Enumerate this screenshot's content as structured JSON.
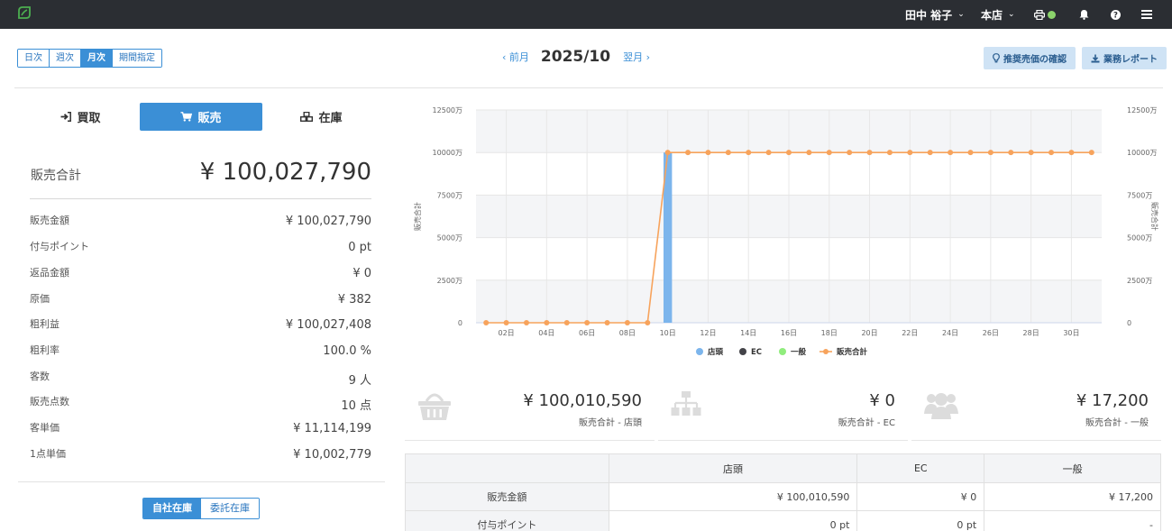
{
  "header": {
    "user": "田中 裕子",
    "store": "本店",
    "icons": [
      "leaf-logo-icon",
      "printer-icon",
      "status-dot-icon",
      "bell-icon",
      "help-icon",
      "menu-icon"
    ]
  },
  "period": {
    "tabs": [
      "日次",
      "週次",
      "月次",
      "期間指定"
    ],
    "active": "月次",
    "prev": "‹ 前月",
    "current": "2025/10",
    "next": "翌月 ›"
  },
  "actions": {
    "recommend": "推奨売価の確認",
    "report": "業務レポート"
  },
  "modes": {
    "buy": "買取",
    "sell": "販売",
    "stock": "在庫",
    "active": "販売"
  },
  "summary": {
    "total_label": "販売合計",
    "total_value": "¥ 100,027,790",
    "rows": [
      {
        "label": "販売金額",
        "value": "¥ 100,027,790"
      },
      {
        "label": "付与ポイント",
        "value": "0 pt"
      },
      {
        "label": "返品金額",
        "value": "¥ 0"
      },
      {
        "label": "原価",
        "value": "¥ 382"
      },
      {
        "label": "粗利益",
        "value": "¥ 100,027,408"
      },
      {
        "label": "粗利率",
        "value": "100.0 %"
      },
      {
        "label": "客数",
        "value": "9 人"
      },
      {
        "label": "販売点数",
        "value": "10 点"
      },
      {
        "label": "客単価",
        "value": "¥ 11,114,199"
      },
      {
        "label": "1点単価",
        "value": "¥ 10,002,779"
      }
    ]
  },
  "inventory_tabs": {
    "own": "自社在庫",
    "consign": "委託在庫",
    "active": "自社在庫"
  },
  "chart_data": {
    "type": "bar",
    "ylabel": "販売合計",
    "y2label": "販売合計",
    "ylim": [
      0,
      125000000
    ],
    "yticks": [
      "0",
      "2500万",
      "5000万",
      "7500万",
      "10000万",
      "12500万"
    ],
    "xticks": [
      "02日",
      "04日",
      "06日",
      "08日",
      "10日",
      "12日",
      "14日",
      "16日",
      "18日",
      "20日",
      "22日",
      "24日",
      "26日",
      "28日",
      "30日"
    ],
    "days": [
      1,
      2,
      3,
      4,
      5,
      6,
      7,
      8,
      9,
      10,
      11,
      12,
      13,
      14,
      15,
      16,
      17,
      18,
      19,
      20,
      21,
      22,
      23,
      24,
      25,
      26,
      27,
      28,
      29,
      30,
      31
    ],
    "bars": {
      "name": "店頭",
      "day": 10,
      "value": 100010590,
      "color": "#7cb5ec"
    },
    "line": {
      "name": "販売合計",
      "color": "#f7a35c",
      "values": [
        0,
        0,
        0,
        0,
        0,
        0,
        0,
        0,
        0,
        100027790,
        100027790,
        100027790,
        100027790,
        100027790,
        100027790,
        100027790,
        100027790,
        100027790,
        100027790,
        100027790,
        100027790,
        100027790,
        100027790,
        100027790,
        100027790,
        100027790,
        100027790,
        100027790,
        100027790,
        100027790,
        100027790
      ]
    },
    "legend": [
      {
        "name": "店頭",
        "color": "#7cb5ec",
        "kind": "dot"
      },
      {
        "name": "EC",
        "color": "#434348",
        "kind": "dot"
      },
      {
        "name": "一般",
        "color": "#90ed7d",
        "kind": "dot"
      },
      {
        "name": "販売合計",
        "color": "#f7a35c",
        "kind": "line"
      }
    ],
    "legend_position": "bottom-center",
    "grid": true
  },
  "cards": [
    {
      "value": "¥ 100,010,590",
      "label": "販売合計 - 店頭",
      "icon": "basket-icon"
    },
    {
      "value": "¥ 0",
      "label": "販売合計 - EC",
      "icon": "sitemap-icon"
    },
    {
      "value": "¥ 17,200",
      "label": "販売合計 - 一般",
      "icon": "users-icon"
    }
  ],
  "table": {
    "headers": [
      "",
      "店頭",
      "EC",
      "一般"
    ],
    "rows": [
      [
        "販売金額",
        "¥ 100,010,590",
        "¥ 0",
        "¥ 17,200"
      ],
      [
        "付与ポイント",
        "0 pt",
        "0 pt",
        "-"
      ]
    ]
  }
}
